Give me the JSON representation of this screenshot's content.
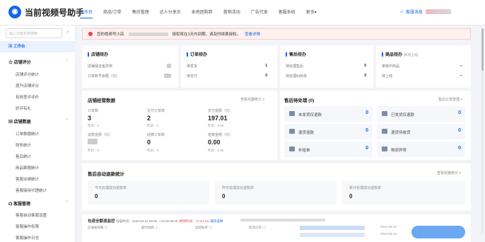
{
  "app": {
    "title": "当前视频号助手"
  },
  "nav": [
    "工作台",
    "商品/订单",
    "售后管理",
    "达人分享员",
    "本地团购券",
    "营销活动",
    "广告代发",
    "客服系统",
    "更多"
  ],
  "user": {
    "label": "客服消息"
  },
  "sidebar": {
    "search_placeholder": "输入功能名称搜索",
    "items": [
      {
        "label": "工作台",
        "type": "active"
      },
      {
        "label": "店铺评分",
        "type": "group"
      },
      {
        "label": "店铺评分统计",
        "type": "item"
      },
      {
        "label": "提升店铺评分",
        "type": "item"
      },
      {
        "label": "有效差评评价",
        "type": "item"
      },
      {
        "label": "好评有礼",
        "type": "item"
      },
      {
        "label": "店铺数据",
        "type": "group"
      },
      {
        "label": "订单数据统计",
        "type": "item"
      },
      {
        "label": "财务统计",
        "type": "item"
      },
      {
        "label": "售后统计",
        "type": "item"
      },
      {
        "label": "商品数据统计",
        "type": "item"
      },
      {
        "label": "客服业绩统计",
        "type": "item"
      },
      {
        "label": "客服接待代理统计",
        "type": "item"
      },
      {
        "label": "客服管理",
        "type": "group"
      },
      {
        "label": "客服自动客服设置",
        "type": "item"
      },
      {
        "label": "客服操作权限",
        "type": "item"
      },
      {
        "label": "客服操作日志",
        "type": "item"
      }
    ]
  },
  "alert": {
    "prefix": "您的视频号小店",
    "text": "授权将在3天内到期，请及时续费授权。",
    "link": "查看详情"
  },
  "todo": [
    {
      "title": "店铺待办",
      "rows": [
        {
          "label": "店铺保证金异常",
          "value": ""
        },
        {
          "label": "订单账号余额（元）",
          "value": ""
        }
      ]
    },
    {
      "title": "订单待办",
      "rows": [
        {
          "label": "待发货",
          "value": "1"
        },
        {
          "label": "待支付",
          "value": "0"
        }
      ]
    },
    {
      "title": "售后待办",
      "rows": [
        {
          "label": "待处理售后",
          "value": "0"
        },
        {
          "label": "待处理纠纷单",
          "value": "0"
        }
      ]
    },
    {
      "title": "商品待办",
      "subtitle": "(新增上线)",
      "rows": [
        {
          "label": "审核中商品",
          "value": "--"
        },
        {
          "label": "待上线",
          "value": "--"
        }
      ]
    }
  ],
  "ops": {
    "title": "店铺经营数据",
    "more": "查看完整统计 >",
    "stats": [
      {
        "label": "订单数",
        "value": "3",
        "sub": "昨日：0"
      },
      {
        "label": "支付订单数",
        "value": "2",
        "sub": "昨日：0"
      },
      {
        "label": "支付金额（元）",
        "value": "197.01",
        "sub": "昨日：0.00"
      },
      {
        "label": "退款金额（元）",
        "value": "",
        "sub": "昨日：0"
      },
      {
        "label": "结算订单数",
        "value": "0",
        "sub": "昨日：0"
      },
      {
        "label": "结算金额（元）",
        "value": "0.00",
        "sub": "昨日：0.00"
      }
    ]
  },
  "service": {
    "title": "售后待处理 (0)",
    "more": "售后订单管理 >",
    "items": [
      {
        "label": "未发货仅退款",
        "count": "0"
      },
      {
        "label": "已发货仅退款",
        "count": "0"
      },
      {
        "label": "退货退款",
        "count": "0"
      },
      {
        "label": "退货待收货",
        "count": "0"
      },
      {
        "label": "补给单",
        "count": "0"
      },
      {
        "label": "物流异常",
        "count": "0"
      }
    ]
  },
  "refund": {
    "title": "售后自动退款统计",
    "more": "查看完整统计 >",
    "items": [
      {
        "label": "今日处理成功退款单",
        "value": "0"
      },
      {
        "label": "昨日处理成功退款单",
        "value": "0"
      },
      {
        "label": "累计处理成功退款单",
        "value": "0"
      }
    ]
  },
  "bottom": {
    "title": "包退全额退监控",
    "time": "扫描时间：2025-03-22 08:00 ~ 03-29 08:00",
    "update": "(更新时间：17:34:12)",
    "link": "操作说明",
    "cols": [
      "应收账单数 ⓘ",
      "超时退款 ⓘ",
      "出错帐单 ⓘ",
      "取消订单 ⓘ"
    ],
    "dates": [
      "2024-06-23",
      "2024-06-23"
    ]
  }
}
